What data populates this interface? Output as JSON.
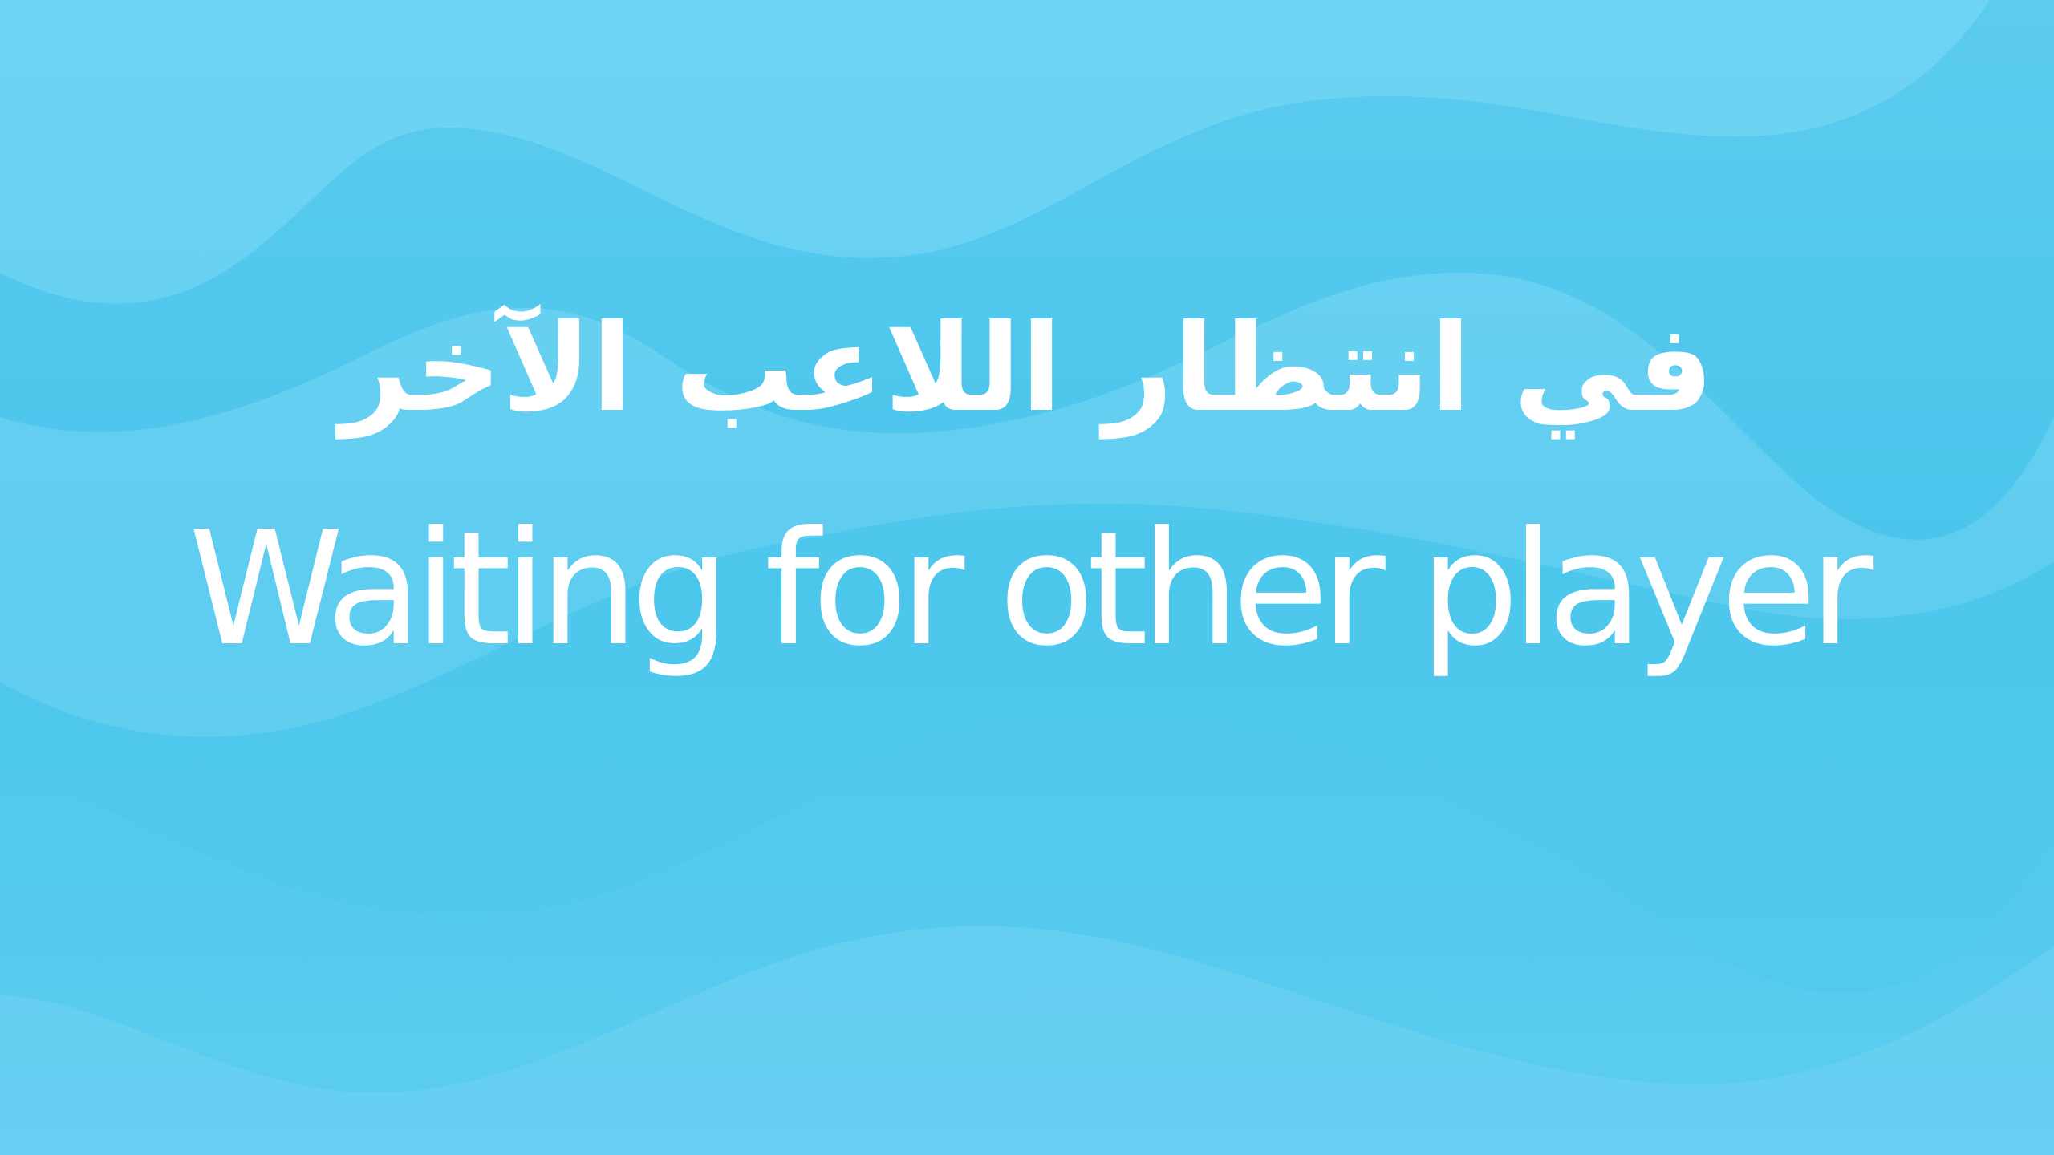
{
  "waiting_screen": {
    "title_arabic": "في انتظار اللاعب الآخر",
    "title_english": "Waiting for other player"
  },
  "colors": {
    "background": "#52c9ee",
    "wave_light": "#7dd8f5",
    "wave_dark": "#45c3ea",
    "text": "#ffffff"
  }
}
